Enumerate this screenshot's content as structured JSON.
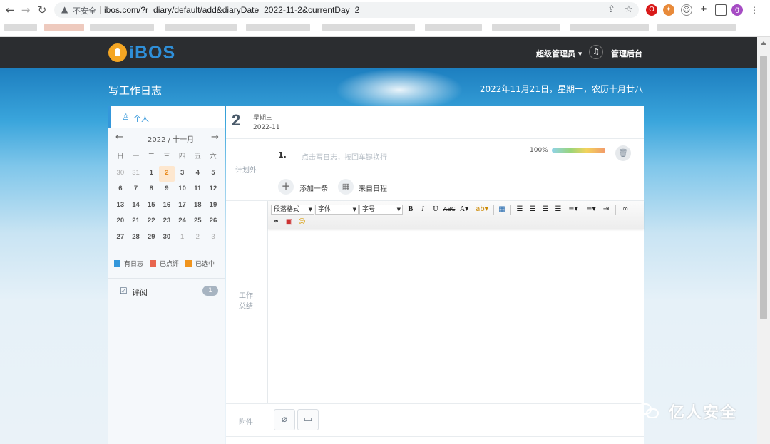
{
  "browser": {
    "insecure_label": "不安全",
    "url": "ibos.com/?r=diary/default/add&diaryDate=2022-11-2&currentDay=2",
    "profile_initial": "g"
  },
  "header": {
    "logo_text": "iBOS",
    "admin_menu": "超级管理员 ▾",
    "backend_link": "管理后台"
  },
  "hero": {
    "title": "写工作日志",
    "date_line": "2022年11月21日，星期一，农历十月廿八"
  },
  "sidebar": {
    "personal_label": "个人",
    "calendar_title": "2022 / 十一月",
    "weekdays": [
      "日",
      "一",
      "二",
      "三",
      "四",
      "五",
      "六"
    ],
    "weeks": [
      [
        "30",
        "31",
        "1",
        "2",
        "3",
        "4",
        "5"
      ],
      [
        "6",
        "7",
        "8",
        "9",
        "10",
        "11",
        "12"
      ],
      [
        "13",
        "14",
        "15",
        "16",
        "17",
        "18",
        "19"
      ],
      [
        "20",
        "21",
        "22",
        "23",
        "24",
        "25",
        "26"
      ],
      [
        "27",
        "28",
        "29",
        "30",
        "1",
        "2",
        "3"
      ]
    ],
    "selected_day": "2",
    "legend": [
      {
        "label": "有日志",
        "color": "#3497db"
      },
      {
        "label": "已点评",
        "color": "#e8664f"
      },
      {
        "label": "已选中",
        "color": "#f0941e"
      }
    ],
    "review_label": "评阅",
    "review_count": "1"
  },
  "diary": {
    "day_number": "2",
    "weekday": "星期三",
    "year_month": "2022-11",
    "plan_section_label": "计划外",
    "plan_item_number": "1.",
    "plan_placeholder": "点击写日志，按回车键换行",
    "progress_text": "100%",
    "progress_value": 100,
    "add_item_label": "添加一条",
    "from_schedule_label": "来自日程",
    "summary_section_label_1": "工作",
    "summary_section_label_2": "总结",
    "attachment_label": "附件"
  },
  "editor_toolbar": {
    "paragraph_select": "段落格式",
    "font_select": "字体",
    "size_select": "字号"
  },
  "watermark": {
    "text": "亿人安全"
  },
  "colors": {
    "accent": "#3497db",
    "topbar": "#2b2d30",
    "selected_day_bg": "#fde7cf"
  }
}
